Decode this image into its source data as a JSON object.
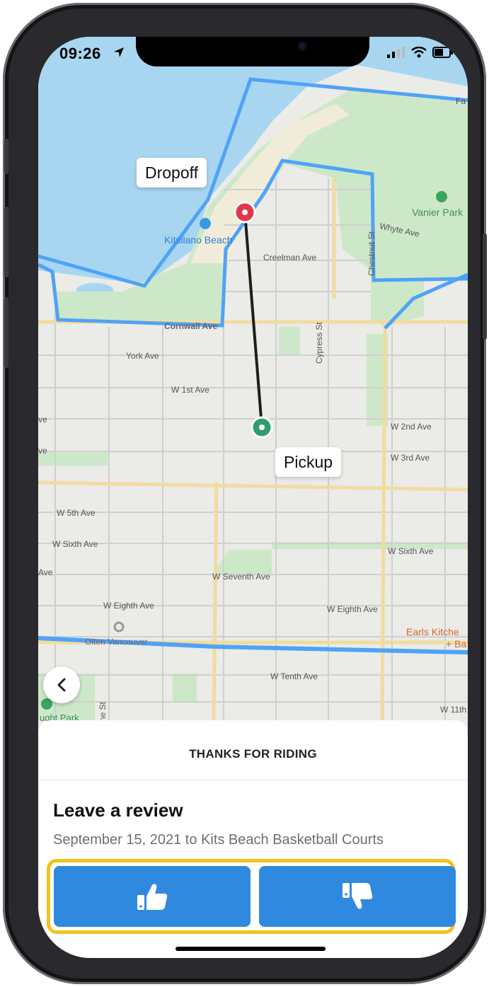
{
  "status_bar": {
    "time": "09:26"
  },
  "map": {
    "dropoff_label": "Dropoff",
    "pickup_label": "Pickup",
    "streets": {
      "creelman": "Creelman Ave",
      "cornwall": "Cornwall Ave",
      "york": "York Ave",
      "w1st": "W 1st Ave",
      "w2nd": "W 2nd Ave",
      "w3rd": "W 3rd Ave",
      "w5th": "W 5th Ave",
      "wsixth_left": "W Sixth Ave",
      "wsixth_right": "W Sixth Ave",
      "wseventh": "W Seventh Ave",
      "weighth_left": "W Eighth Ave",
      "weighth_right": "W Eighth Ave",
      "wtenth": "W Tenth Ave",
      "w11th": "W 11th",
      "cypress": "Cypress St",
      "chestnut": "Chestnut St",
      "whyte": "Whyte Ave",
      "ve1": "ve",
      "ve2": "ve",
      "ave": "Ave",
      "fa": "Fa",
      "ne_st": "ne St",
      "olten": "Olten Vancouver"
    },
    "pois": {
      "kits_beach": "Kitsilano Beach",
      "vanier": "Vanier Park",
      "earls": "Earls Kitche",
      "earls2": "+ Ba",
      "hought": "ught Park"
    },
    "colors": {
      "water": "#a8d6f1",
      "park": "#cde8c8",
      "boundary": "#4fa3f7",
      "route": "#1e1e1e",
      "dropoff_pin": "#e2374a",
      "pickup_pin": "#2e9e6b"
    }
  },
  "sheet": {
    "title": "THANKS FOR RIDING",
    "heading": "Leave a review",
    "subtitle": "September 15, 2021 to Kits Beach Basketball Courts",
    "thumbs_up_icon": "thumbs-up-icon",
    "thumbs_down_icon": "thumbs-down-icon",
    "button_color": "#2f89df",
    "highlight_color": "#f4c21b"
  }
}
